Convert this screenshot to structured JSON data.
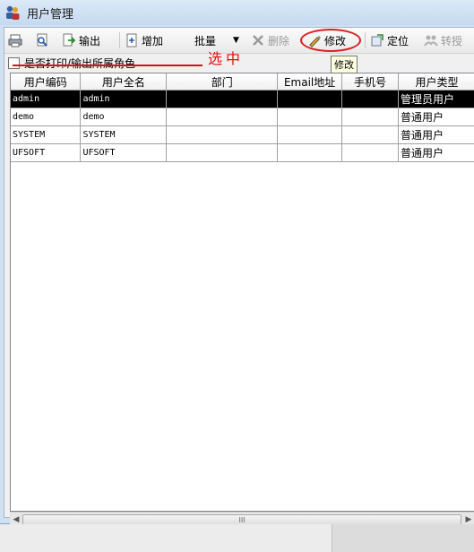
{
  "window": {
    "title": "用户管理"
  },
  "toolbar": {
    "export_label": "输出",
    "add_label": "增加",
    "batch_label": "批量",
    "delete_label": "删除",
    "modify_label": "修改",
    "locate_label": "定位",
    "transfer_label": "转授"
  },
  "tooltip": {
    "text": "修改"
  },
  "option": {
    "label": "是否打印/输出所属角色",
    "checked": false
  },
  "table": {
    "headers": [
      "用户编码",
      "用户全名",
      "部门",
      "Email地址",
      "手机号",
      "用户类型"
    ],
    "rows": [
      {
        "code": "admin",
        "name": "admin",
        "dept": "",
        "email": "",
        "phone": "",
        "type": "管理员用户",
        "selected": true
      },
      {
        "code": "demo",
        "name": "demo",
        "dept": "",
        "email": "",
        "phone": "",
        "type": "普通用户",
        "selected": false
      },
      {
        "code": "SYSTEM",
        "name": "SYSTEM",
        "dept": "",
        "email": "",
        "phone": "",
        "type": "普通用户",
        "selected": false
      },
      {
        "code": "UFSOFT",
        "name": "UFSOFT",
        "dept": "",
        "email": "",
        "phone": "",
        "type": "普通用户",
        "selected": false
      }
    ]
  },
  "annotation": {
    "text": "选中",
    "color": "#e01010"
  },
  "colors": {
    "selected_row_bg": "#000000",
    "annotation": "#e01010",
    "tooltip_bg": "#ffffe1"
  },
  "scrollbar": {
    "thumb_grip": "III"
  }
}
